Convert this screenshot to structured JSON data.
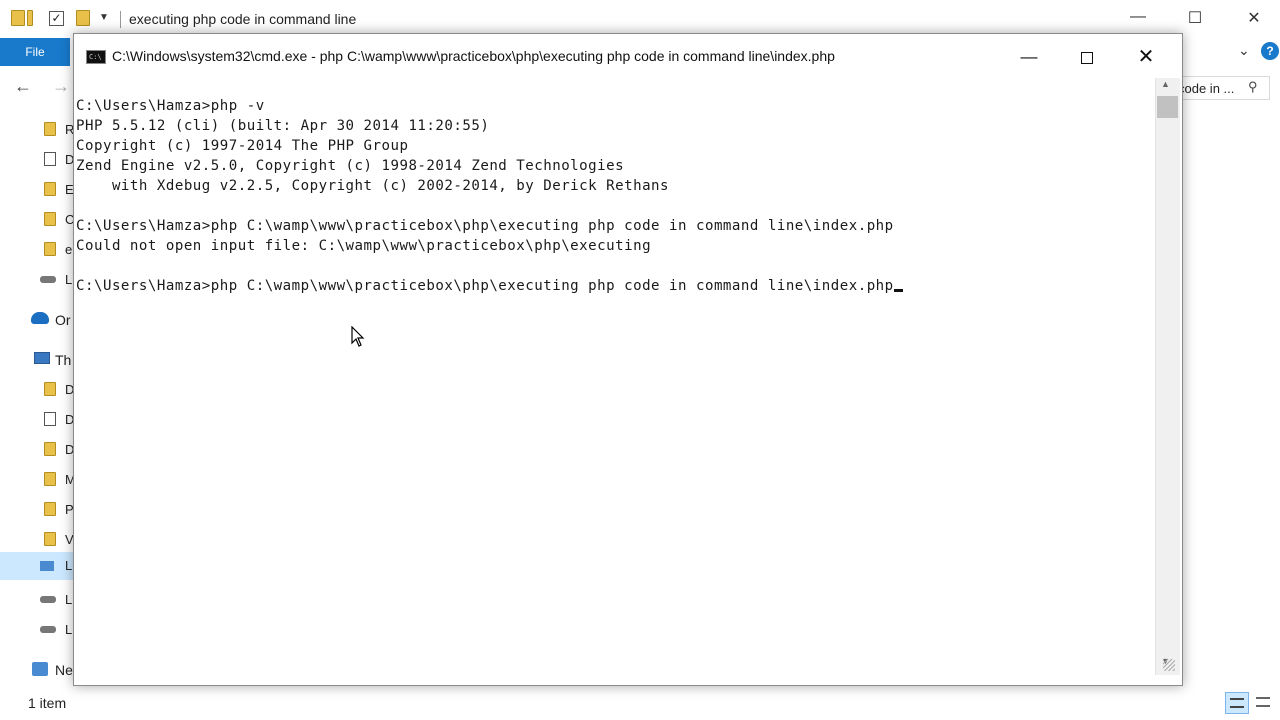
{
  "explorer": {
    "title": "executing php code in command line",
    "file_tab": "File",
    "search_text": "code in ...",
    "nav_items": [
      {
        "label": "R"
      },
      {
        "label": "D"
      },
      {
        "label": "E"
      },
      {
        "label": "C"
      },
      {
        "label": "e"
      },
      {
        "label": "L"
      },
      {
        "label": "Or"
      },
      {
        "label": "Th"
      },
      {
        "label": "D"
      },
      {
        "label": "D"
      },
      {
        "label": "D"
      },
      {
        "label": "M"
      },
      {
        "label": "P"
      },
      {
        "label": "V"
      },
      {
        "label": "L"
      },
      {
        "label": "L"
      },
      {
        "label": "L"
      },
      {
        "label": "Ne"
      }
    ],
    "status": "1 item"
  },
  "cmd": {
    "title": "C:\\Windows\\system32\\cmd.exe - php  C:\\wamp\\www\\practicebox\\php\\executing php code in command line\\index.php",
    "icon_text": "C:\\",
    "lines": [
      "C:\\Users\\Hamza>php -v",
      "PHP 5.5.12 (cli) (built: Apr 30 2014 11:20:55)",
      "Copyright (c) 1997-2014 The PHP Group",
      "Zend Engine v2.5.0, Copyright (c) 1998-2014 Zend Technologies",
      "    with Xdebug v2.2.5, Copyright (c) 2002-2014, by Derick Rethans",
      "",
      "C:\\Users\\Hamza>php C:\\wamp\\www\\practicebox\\php\\executing php code in command line\\index.php",
      "Could not open input file: C:\\wamp\\www\\practicebox\\php\\executing",
      "",
      "C:\\Users\\Hamza>php C:\\wamp\\www\\practicebox\\php\\executing php code in command line\\index.php"
    ]
  },
  "colors": {
    "accent": "#1979ca",
    "console_bg": "#ffffff",
    "console_text": "#1a1a1a"
  }
}
